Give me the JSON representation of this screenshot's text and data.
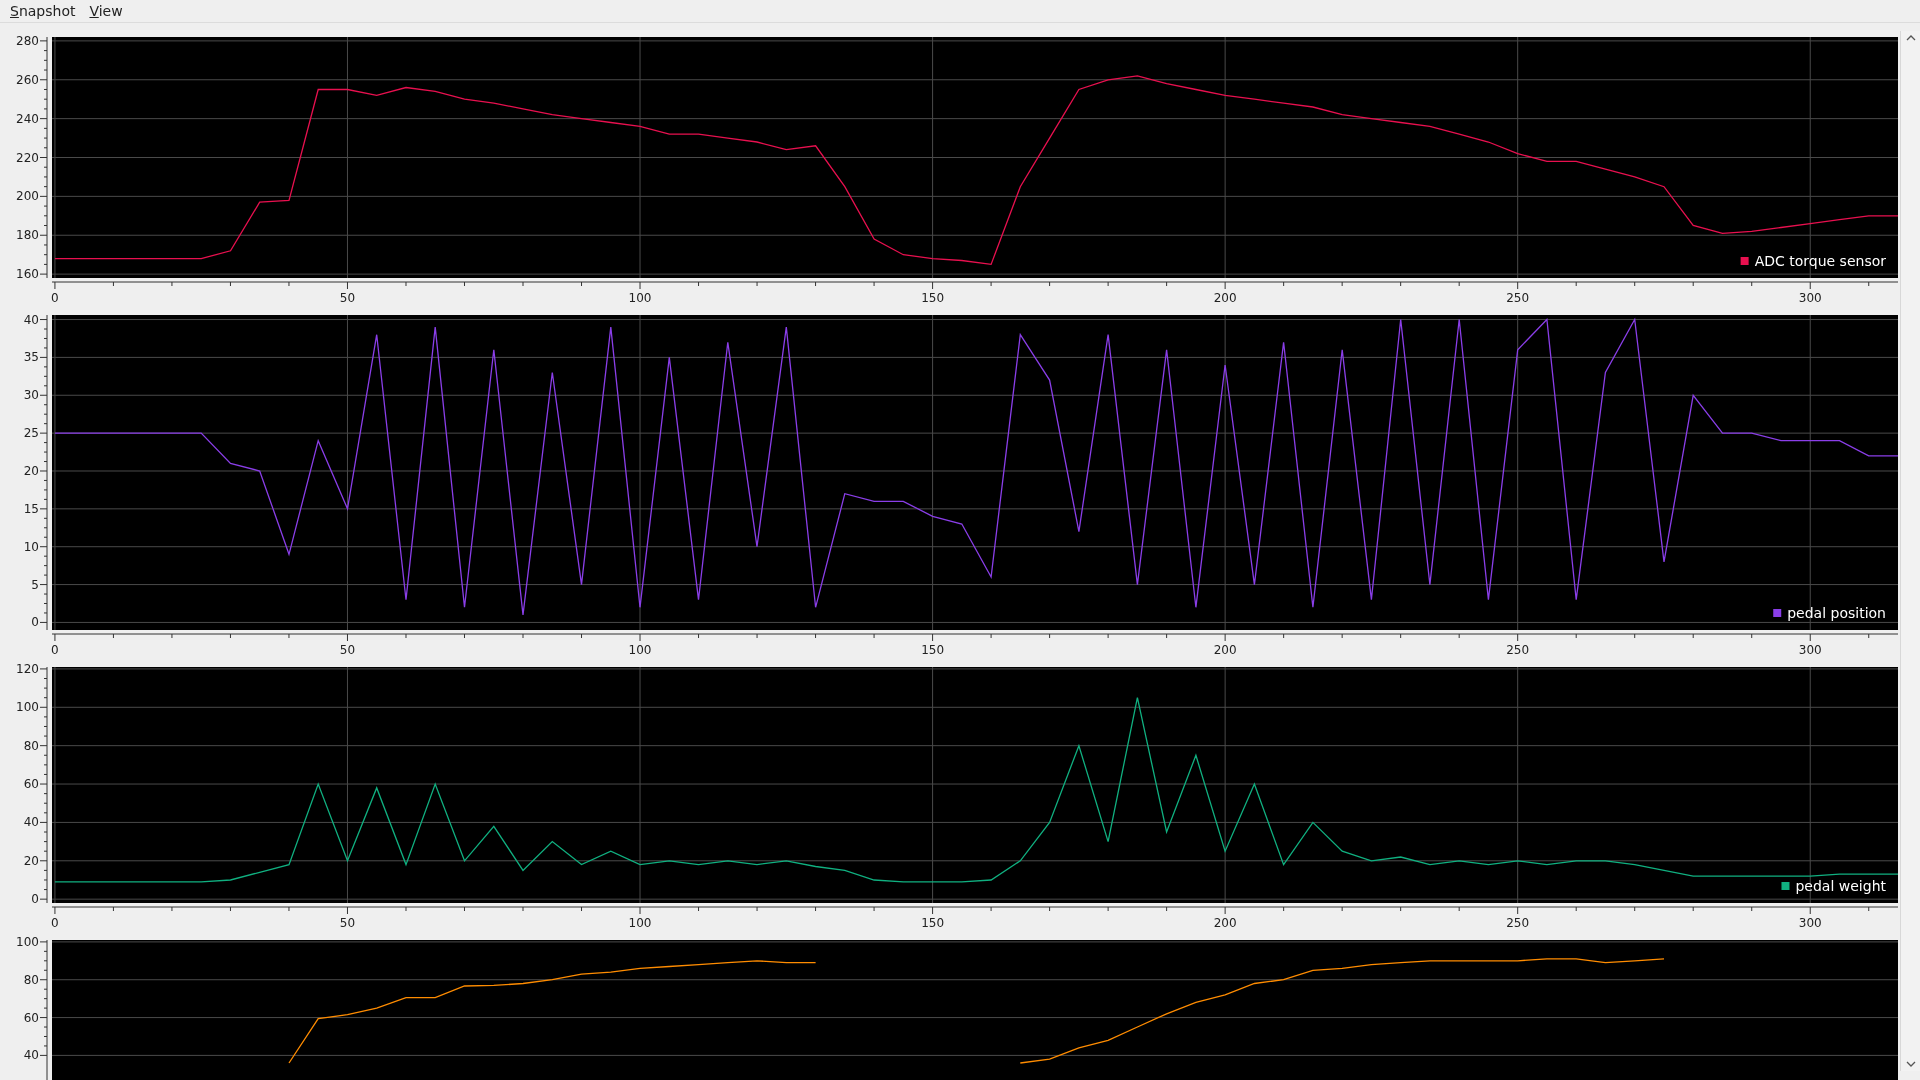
{
  "menu_bar": {
    "items": [
      {
        "label": "Snapshot"
      },
      {
        "label": "View"
      }
    ]
  },
  "charts": [
    {
      "chart_data": {
        "type": "line",
        "x": [
          0,
          5,
          10,
          15,
          20,
          25,
          30,
          35,
          40,
          45,
          50,
          55,
          60,
          65,
          70,
          75,
          80,
          85,
          90,
          95,
          100,
          105,
          110,
          115,
          120,
          125,
          130,
          135,
          140,
          145,
          150,
          155,
          160,
          165,
          170,
          175,
          180,
          185,
          190,
          195,
          200,
          205,
          210,
          215,
          220,
          225,
          230,
          235,
          240,
          245,
          250,
          255,
          260,
          265,
          270,
          275,
          280,
          285,
          290,
          295,
          300,
          305,
          310,
          315
        ],
        "grid": true,
        "xlim": [
          -0.5,
          315
        ],
        "ylim": [
          158,
          282
        ],
        "xticks": [
          0,
          50,
          100,
          150,
          200,
          250,
          300
        ],
        "yticks": [
          160,
          180,
          200,
          220,
          240,
          260,
          280
        ],
        "series": [
          {
            "name": "ADC torque sensor",
            "color": "#e8104f",
            "values": [
              168,
              168,
              168,
              168,
              168,
              168,
              172,
              197,
              198,
              255,
              255,
              252,
              256,
              254,
              250,
              248,
              245,
              242,
              240,
              238,
              236,
              232,
              232,
              230,
              228,
              224,
              226,
              205,
              178,
              170,
              168,
              167,
              165,
              205,
              230,
              255,
              260,
              262,
              258,
              255,
              252,
              250,
              248,
              246,
              242,
              240,
              238,
              236,
              232,
              228,
              222,
              218,
              218,
              214,
              210,
              205,
              185,
              181,
              182,
              184,
              186,
              188,
              190,
              190
            ]
          }
        ]
      }
    },
    {
      "chart_data": {
        "type": "line",
        "x": [
          0,
          5,
          10,
          15,
          20,
          25,
          30,
          35,
          40,
          45,
          50,
          55,
          60,
          65,
          70,
          75,
          80,
          85,
          90,
          95,
          100,
          105,
          110,
          115,
          120,
          125,
          130,
          135,
          140,
          145,
          150,
          155,
          160,
          165,
          170,
          175,
          180,
          185,
          190,
          195,
          200,
          205,
          210,
          215,
          220,
          225,
          230,
          235,
          240,
          245,
          250,
          255,
          260,
          265,
          270,
          275,
          280,
          285,
          290,
          295,
          300,
          305,
          310,
          315
        ],
        "grid": true,
        "xlim": [
          -0.5,
          315
        ],
        "ylim": [
          -1,
          40.6
        ],
        "xticks": [
          0,
          50,
          100,
          150,
          200,
          250,
          300
        ],
        "yticks": [
          0,
          5,
          10,
          15,
          20,
          25,
          30,
          35,
          40
        ],
        "series": [
          {
            "name": "pedal position",
            "color": "#8a3ee8",
            "values": [
              25,
              25,
              25,
              25,
              25,
              25,
              21,
              20,
              9,
              24,
              15,
              38,
              3,
              39,
              2,
              36,
              1,
              33,
              5,
              39,
              2,
              35,
              3,
              37,
              10,
              39,
              2,
              17,
              16,
              16,
              14,
              13,
              6,
              38,
              32,
              12,
              38,
              5,
              36,
              2,
              34,
              5,
              37,
              2,
              36,
              3,
              40,
              5,
              40,
              3,
              36,
              40,
              3,
              33,
              40,
              8,
              30,
              25,
              25,
              24,
              24,
              24,
              22,
              22
            ]
          }
        ]
      }
    },
    {
      "chart_data": {
        "type": "line",
        "x": [
          0,
          5,
          10,
          15,
          20,
          25,
          30,
          35,
          40,
          45,
          50,
          55,
          60,
          65,
          70,
          75,
          80,
          85,
          90,
          95,
          100,
          105,
          110,
          115,
          120,
          125,
          130,
          135,
          140,
          145,
          150,
          155,
          160,
          165,
          170,
          175,
          180,
          185,
          190,
          195,
          200,
          205,
          210,
          215,
          220,
          225,
          230,
          235,
          240,
          245,
          250,
          255,
          260,
          265,
          270,
          275,
          280,
          285,
          290,
          295,
          300,
          305,
          310,
          315
        ],
        "grid": true,
        "xlim": [
          -0.5,
          315
        ],
        "ylim": [
          -2,
          121
        ],
        "xticks": [
          0,
          50,
          100,
          150,
          200,
          250,
          300
        ],
        "yticks": [
          0,
          20,
          40,
          60,
          80,
          100,
          120
        ],
        "series": [
          {
            "name": "pedal weight",
            "color": "#10b080",
            "values": [
              9,
              9,
              9,
              9,
              9,
              9,
              10,
              14,
              18,
              60,
              20,
              58,
              18,
              60,
              20,
              38,
              15,
              30,
              18,
              25,
              18,
              20,
              18,
              20,
              18,
              20,
              17,
              15,
              10,
              9,
              9,
              9,
              10,
              20,
              40,
              80,
              30,
              105,
              35,
              75,
              25,
              60,
              18,
              40,
              25,
              20,
              22,
              18,
              20,
              18,
              20,
              18,
              20,
              20,
              18,
              15,
              12,
              12,
              12,
              12,
              12,
              13,
              13,
              13
            ]
          }
        ]
      }
    },
    {
      "chart_data": {
        "type": "line",
        "x": [
          40,
          45,
          50,
          55,
          60,
          65,
          70,
          75,
          80,
          85,
          90,
          95,
          100,
          105,
          110,
          115,
          120,
          125,
          130,
          135,
          140,
          145,
          150,
          155,
          160,
          165,
          170,
          175,
          180,
          185,
          190,
          195,
          200,
          205,
          210,
          215,
          220,
          225,
          230,
          235,
          240,
          245,
          250,
          255,
          260,
          265,
          270,
          275
        ],
        "grid": true,
        "xlim": [
          -0.5,
          315
        ],
        "ylim": [
          27,
          101
        ],
        "yticks": [
          40,
          60,
          80,
          100
        ],
        "series": [
          {
            "color": "#ff8c00",
            "values": [
              36,
              59.4,
              61.5,
              65,
              70.5,
              70.5,
              76.7,
              77,
              78,
              80,
              83,
              84,
              86,
              87,
              88,
              89,
              90,
              89,
              89,
              null,
              null,
              null,
              null,
              null,
              null,
              36,
              38,
              44,
              48,
              55,
              62,
              68,
              72,
              78,
              80,
              85,
              86,
              88,
              89,
              90,
              90,
              90,
              90,
              91,
              91,
              89,
              90,
              91
            ]
          }
        ]
      }
    }
  ]
}
